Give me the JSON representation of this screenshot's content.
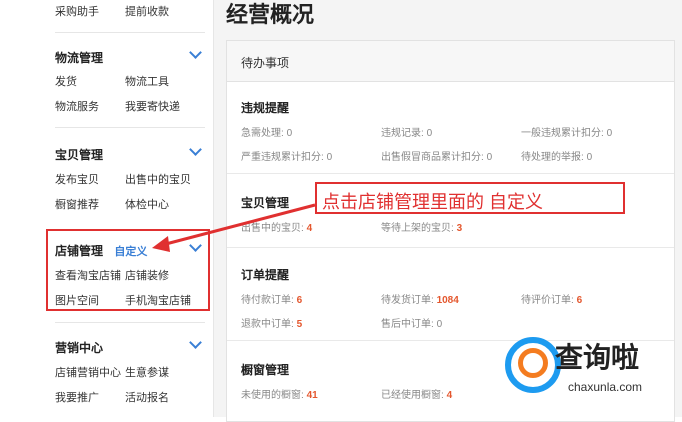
{
  "sidebar": {
    "top_links": [
      "采购助手",
      "提前收款"
    ],
    "sections": [
      {
        "title": "物流管理",
        "links": [
          "发货",
          "物流工具",
          "物流服务",
          "我要寄快递"
        ]
      },
      {
        "title": "宝贝管理",
        "links": [
          "发布宝贝",
          "出售中的宝贝",
          "橱窗推荐",
          "体检中心"
        ]
      },
      {
        "title": "店铺管理",
        "custom": "自定义",
        "links": [
          "查看淘宝店铺",
          "店铺装修",
          "图片空间",
          "手机淘宝店铺"
        ]
      },
      {
        "title": "营销中心",
        "links": [
          "店铺营销中心",
          "生意参谋",
          "我要推广",
          "活动报名"
        ]
      }
    ]
  },
  "main": {
    "title": "经营概况",
    "card_header": "待办事项",
    "blocks": [
      {
        "title": "违规提醒",
        "items": [
          {
            "label": "急需处理:",
            "value": "0"
          },
          {
            "label": "违规记录:",
            "value": "0"
          },
          {
            "label": "一般违规累计扣分:",
            "value": "0"
          },
          {
            "label": "严重违规累计扣分:",
            "value": "0"
          },
          {
            "label": "出售假冒商品累计扣分:",
            "value": "0"
          },
          {
            "label": "待处理的举报:",
            "value": "0"
          }
        ]
      },
      {
        "title": "宝贝管理",
        "items": [
          {
            "label": "出售中的宝贝:",
            "value": "4"
          },
          {
            "label": "等待上架的宝贝:",
            "value": "3"
          }
        ]
      },
      {
        "title": "订单提醒",
        "items": [
          {
            "label": "待付款订单:",
            "value": "6"
          },
          {
            "label": "待发货订单:",
            "value": "1084"
          },
          {
            "label": "待评价订单:",
            "value": "6"
          },
          {
            "label": "退款中订单:",
            "value": "5"
          },
          {
            "label": "售后中订单:",
            "value": "0"
          }
        ]
      },
      {
        "title": "橱窗管理",
        "items": [
          {
            "label": "未使用的橱窗:",
            "value": "41"
          },
          {
            "label": "已经使用橱窗:",
            "value": "4"
          }
        ]
      }
    ]
  },
  "annotation": "点击店铺管理里面的 自定义",
  "watermark": {
    "name": "查询啦",
    "url": "chaxunla.com"
  },
  "colors": {
    "accent": "#3a7fd5",
    "highlight": "#e4572e",
    "annotation": "#e03030"
  }
}
